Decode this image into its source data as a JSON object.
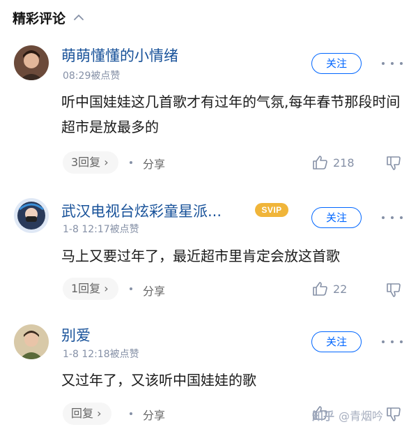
{
  "header": {
    "title": "精彩评论"
  },
  "comments": [
    {
      "username": "萌萌懂懂的小情绪",
      "meta": "08:29被点赞",
      "follow_label": "关注",
      "content": "听中国娃娃这几首歌才有过年的气氛,每年春节那段时间超市是放最多的",
      "reply_label": "3回复",
      "share_label": "分享",
      "likes": "218"
    },
    {
      "username": "武汉电视台炫彩童星派...",
      "badge": "SVIP",
      "meta": "1-8 12:17被点赞",
      "follow_label": "关注",
      "content": "马上又要过年了，最近超市里肯定会放这首歌",
      "reply_label": "1回复",
      "share_label": "分享",
      "likes": "22"
    },
    {
      "username": "别爱",
      "meta": "1-8 12:18被点赞",
      "follow_label": "关注",
      "content": "又过年了，又该听中国娃娃的歌",
      "reply_label": "回复",
      "share_label": "分享",
      "likes": ""
    }
  ],
  "watermark": {
    "logo": "知乎",
    "author": "@青烟吟"
  },
  "colors": {
    "username": "#175199",
    "accent": "#0066ff",
    "meta": "#8590a6",
    "svip": "#f0b53a"
  }
}
